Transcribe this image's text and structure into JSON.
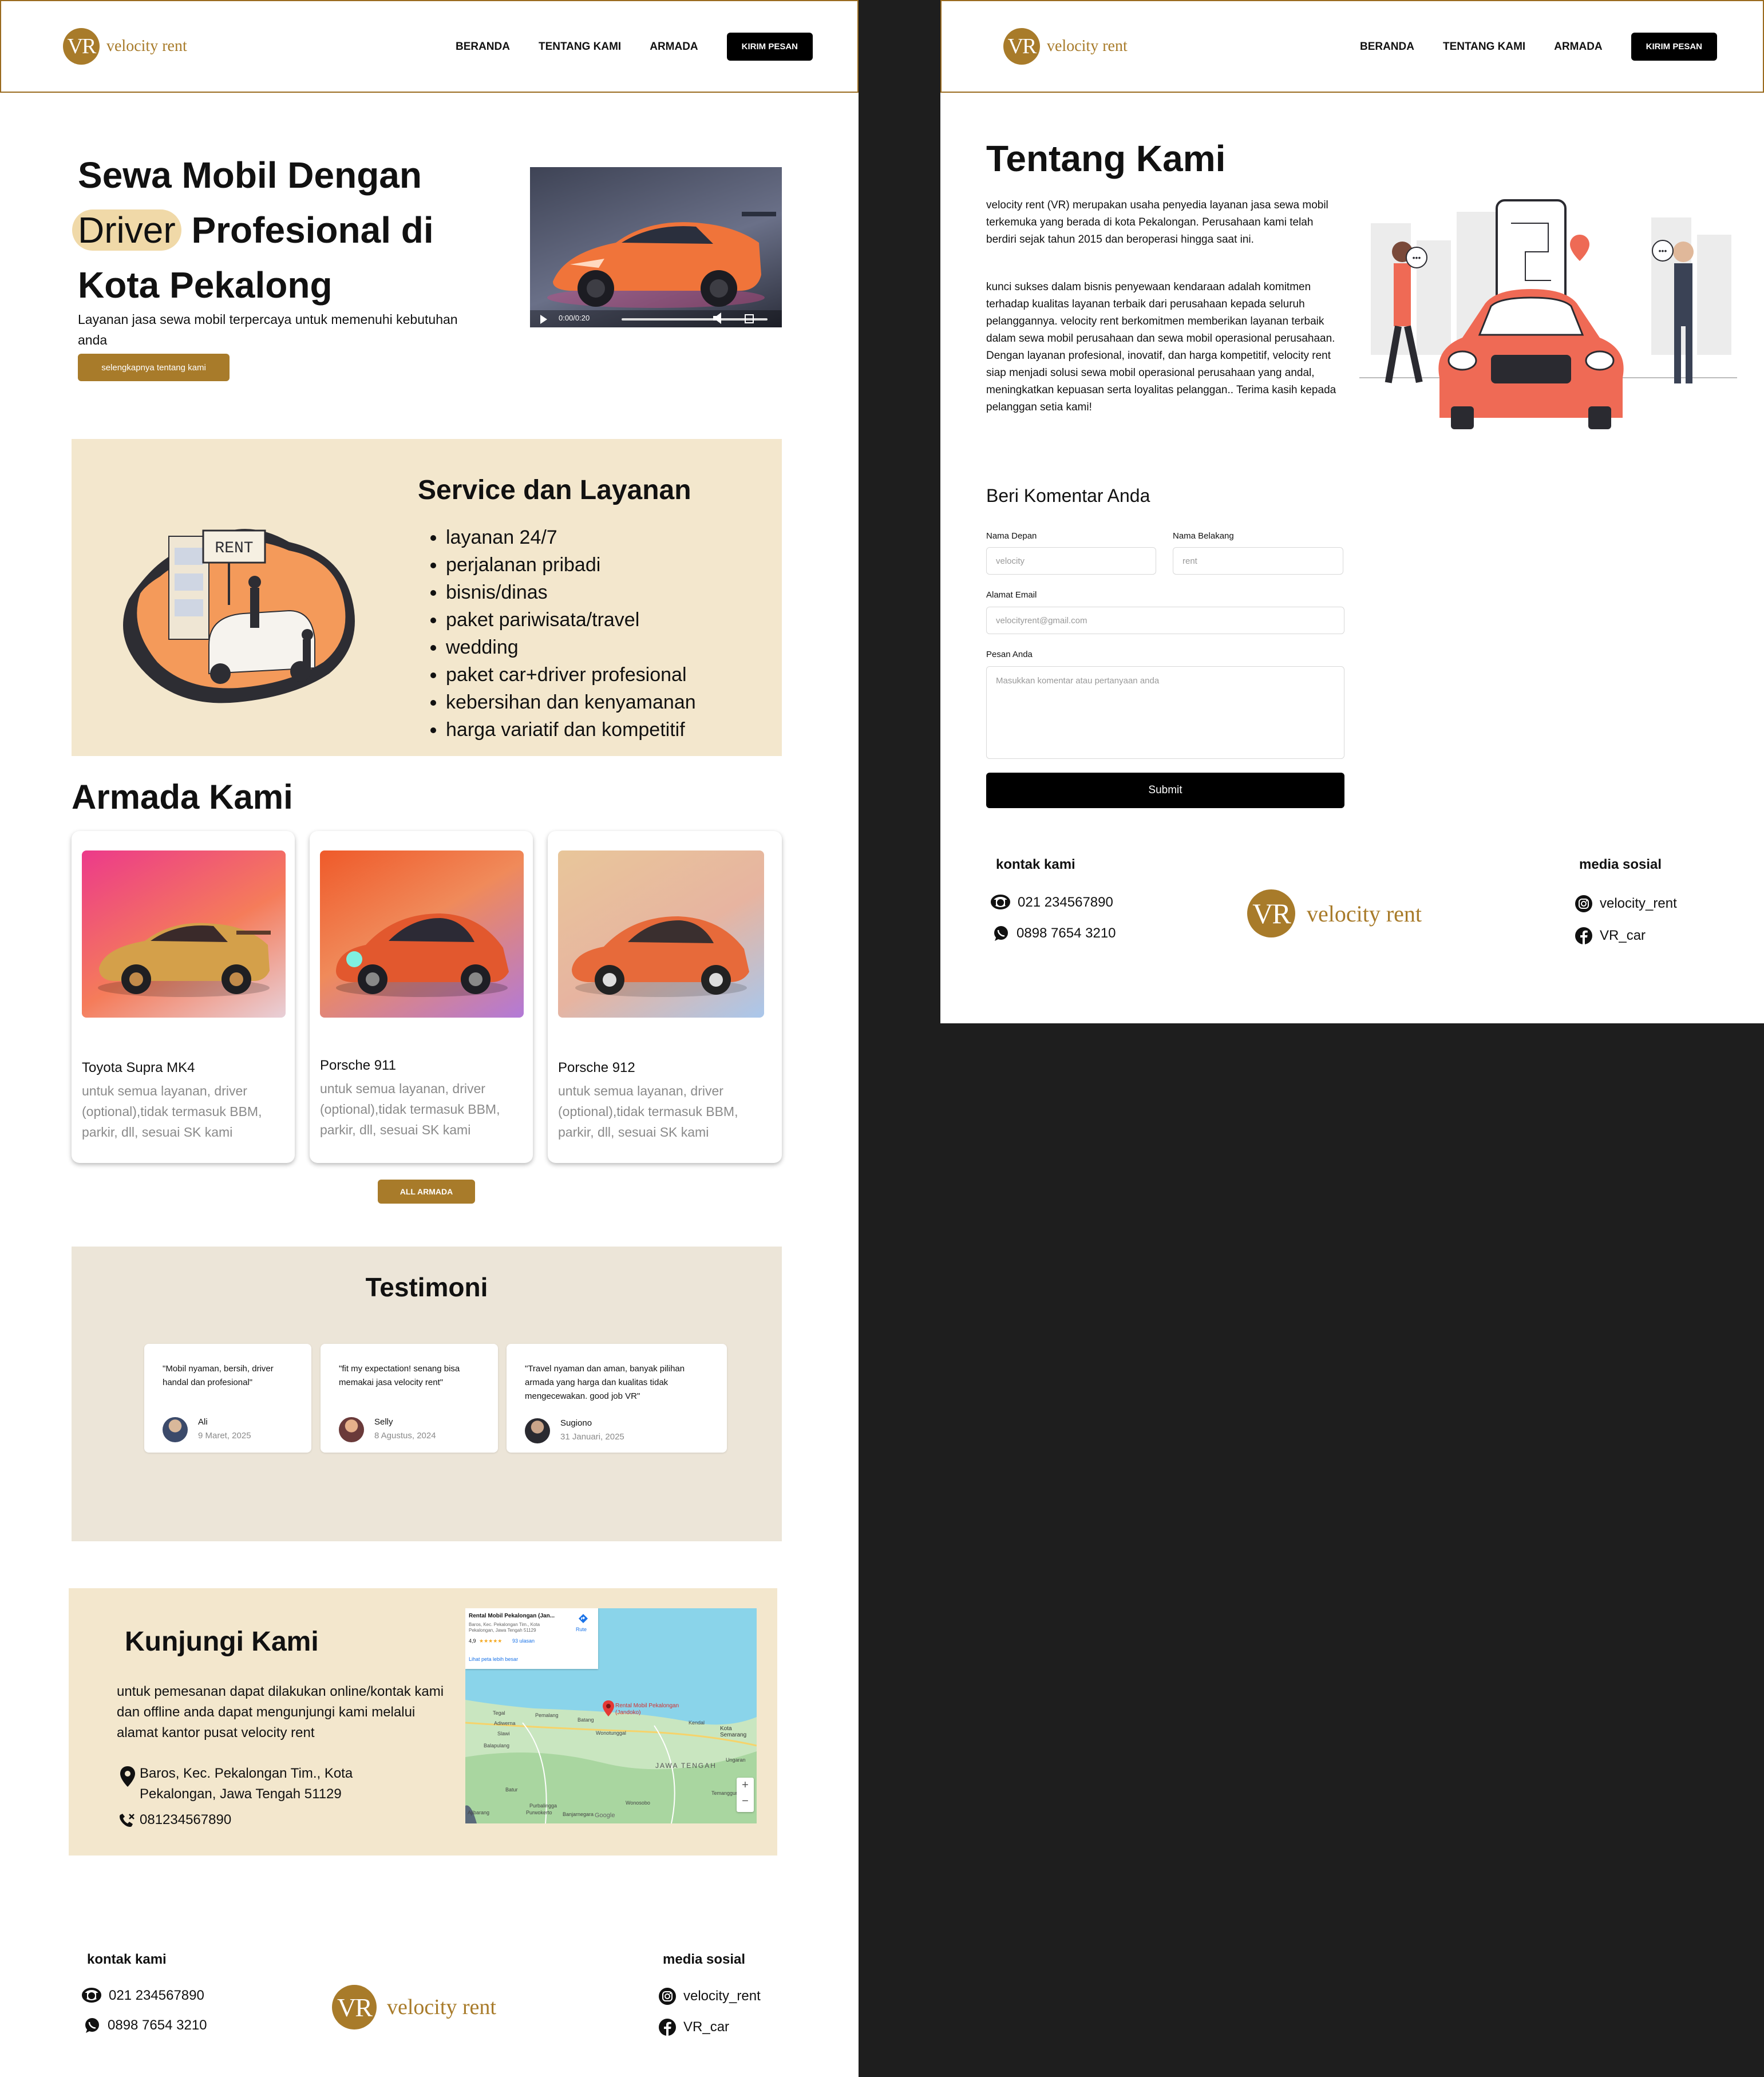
{
  "brand": {
    "logo_mark": "VR",
    "logo_text": "velocity rent",
    "accent": "#a87b2a",
    "cream": "#f3e7cd"
  },
  "nav": {
    "items": [
      "BERANDA",
      "TENTANG KAMI",
      "ARMADA"
    ],
    "cta": "KIRIM PESAN"
  },
  "hero": {
    "line1": "Sewa Mobil Dengan",
    "highlight": "Driver",
    "line2_rest": " Profesional di",
    "line3": "Kota Pekalong",
    "subtitle": "Layanan jasa sewa mobil terpercaya untuk memenuhi kebutuhan anda",
    "button": "selengkapnya tentang kami",
    "video_time": "0:00/0:20"
  },
  "service": {
    "title": "Service dan Layanan",
    "items": [
      "layanan 24/7",
      "perjalanan pribadi",
      "bisnis/dinas",
      "paket pariwisata/travel",
      "wedding",
      "paket car+driver profesional",
      "kebersihan dan kenyamanan",
      "harga variatif dan kompetitif"
    ],
    "sign_text": "RENT"
  },
  "armada": {
    "title": "Armada Kami",
    "cars": [
      {
        "name": "Toyota Supra MK4",
        "desc": "untuk semua layanan, driver (optional),tidak termasuk BBM, parkir, dll, sesuai SK kami"
      },
      {
        "name": "Porsche 911",
        "desc": "untuk semua layanan, driver (optional),tidak termasuk BBM, parkir, dll, sesuai SK kami"
      },
      {
        "name": "Porsche 912",
        "desc": "untuk semua layanan, driver (optional),tidak termasuk BBM, parkir, dll, sesuai SK kami"
      }
    ],
    "button": "ALL ARMADA"
  },
  "testimoni": {
    "title": "Testimoni",
    "items": [
      {
        "quote": "\"Mobil nyaman, bersih, driver handal dan profesional\"",
        "name": "Ali",
        "date": "9 Maret, 2025"
      },
      {
        "quote": "\"fit my expectation! senang bisa memakai jasa velocity rent\"",
        "name": "Selly",
        "date": "8 Agustus, 2024"
      },
      {
        "quote": "\"Travel nyaman dan aman, banyak pilihan armada yang harga dan kualitas tidak mengecewakan. good job VR\"",
        "name": "Sugiono",
        "date": "31 Januari, 2025"
      }
    ]
  },
  "visit": {
    "title": "Kunjungi Kami",
    "text": "untuk pemesanan dapat dilakukan online/kontak kami dan  offline anda dapat mengunjungi kami melalui alamat kantor pusat velocity rent",
    "address": "Baros, Kec. Pekalongan Tim., Kota Pekalongan, Jawa Tengah 51129",
    "phone": "081234567890",
    "map": {
      "place_title": "Rental Mobil Pekalongan (Jan...",
      "place_address": "Baros, Kec. Pekalongan Tim., Kota Pekalongan, Jawa Tengah 51129",
      "rating": "4,9",
      "stars": "★★★★★",
      "reviews": "93 ulasan",
      "larger_map": "Lihat peta lebih besar",
      "route": "Rute",
      "pin_label": "Rental Mobil Pekalongan (Jandoko)",
      "places": [
        "Tegal",
        "Pemalang",
        "Batang",
        "Kendal",
        "Kota Semarang",
        "Adiwerna",
        "Slawi",
        "Balapulang",
        "Wonotunggal",
        "JAWA TENGAH",
        "Ungaran",
        "Temanggung",
        "Batur",
        "Wonosobo",
        "Purbalingga",
        "Banjarnegara",
        "Purwokerto",
        "Ajibarang"
      ],
      "google": "Google",
      "zoom_in": "+",
      "zoom_out": "−"
    }
  },
  "footer": {
    "contact_title": "kontak kami",
    "phone": "021 234567890",
    "whatsapp": "0898 7654 3210",
    "social_title": "media sosial",
    "instagram": "velocity_rent",
    "facebook": "VR_car"
  },
  "about": {
    "title": "Tentang Kami",
    "para1": "velocity rent (VR) merupakan usaha penyedia layanan jasa sewa mobil terkemuka yang berada di kota Pekalongan. Perusahaan kami telah berdiri sejak tahun 2015 dan beroperasi hingga saat ini.",
    "para2": "kunci sukses dalam bisnis penyewaan kendaraan adalah komitmen terhadap kualitas layanan terbaik dari perusahaan kepada seluruh pelanggannya. velocity rent berkomitmen memberikan layanan terbaik dalam sewa mobil perusahaan dan sewa mobil operasional perusahaan. Dengan layanan profesional, inovatif, dan harga kompetitif, velocity rent  siap menjadi solusi sewa mobil operasional perusahaan yang andal, meningkatkan kepuasan serta loyalitas pelanggan.. Terima kasih kepada pelanggan setia kami!"
  },
  "comment_form": {
    "title": "Beri Komentar Anda",
    "first_label": "Nama Depan",
    "first_placeholder": "velocity",
    "last_label": "Nama Belakang",
    "last_placeholder": "rent",
    "email_label": "Alamat Email",
    "email_placeholder": "velocityrent@gmail.com",
    "message_label": "Pesan Anda",
    "message_placeholder": "Masukkan komentar atau pertanyaan anda",
    "submit": "Submit"
  }
}
